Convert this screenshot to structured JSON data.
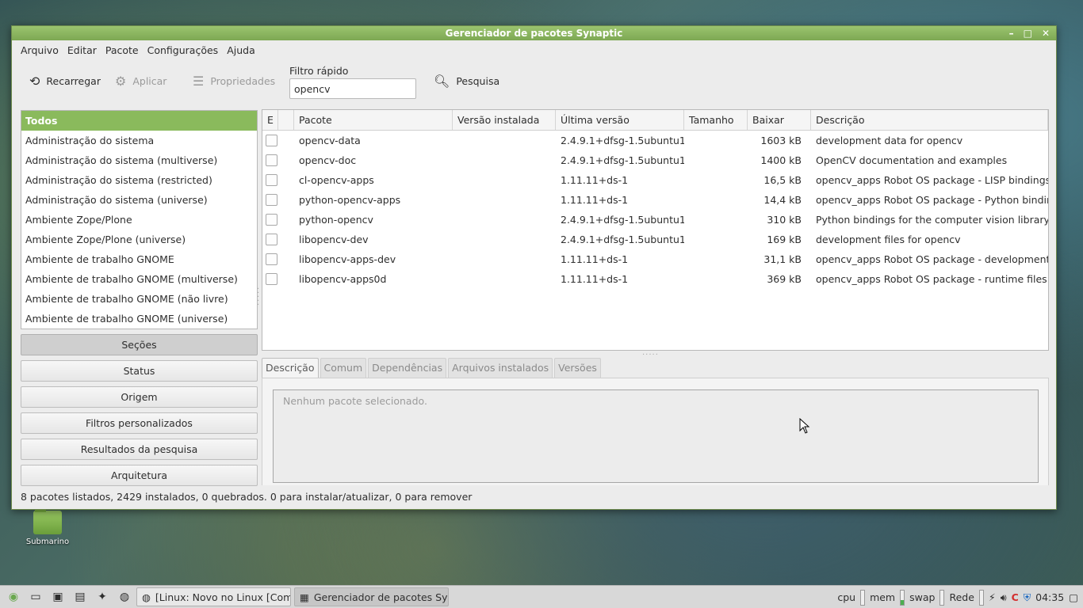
{
  "desktop": {
    "icon_label": "Submarino"
  },
  "window": {
    "title": "Gerenciador de pacotes Synaptic",
    "controls": [
      "–",
      "□",
      "✕"
    ]
  },
  "menu": [
    "Arquivo",
    "Editar",
    "Pacote",
    "Configurações",
    "Ajuda"
  ],
  "toolbar": {
    "reload": "Recarregar",
    "apply": "Aplicar",
    "properties": "Propriedades",
    "filter_label": "Filtro rápido",
    "filter_value": "opencv",
    "search": "Pesquisa"
  },
  "categories": [
    "Todos",
    "Administração do sistema",
    "Administração do sistema (multiverse)",
    "Administração do sistema (restricted)",
    "Administração do sistema (universe)",
    "Ambiente Zope/Plone",
    "Ambiente Zope/Plone (universe)",
    "Ambiente de trabalho GNOME",
    "Ambiente de trabalho GNOME (multiverse)",
    "Ambiente de trabalho GNOME (não livre)",
    "Ambiente de trabalho GNOME (universe)"
  ],
  "side_buttons": [
    "Seções",
    "Status",
    "Origem",
    "Filtros personalizados",
    "Resultados da pesquisa",
    "Arquitetura"
  ],
  "table": {
    "headers": [
      "E",
      "",
      "Pacote",
      "Versão instalada",
      "Última versão",
      "Tamanho",
      "Baixar",
      "Descrição"
    ],
    "rows": [
      {
        "pkg": "opencv-data",
        "installed": "",
        "latest": "2.4.9.1+dfsg-1.5ubuntu1.1",
        "size": "",
        "download": "1603 kB",
        "desc": "development data for opencv"
      },
      {
        "pkg": "opencv-doc",
        "installed": "",
        "latest": "2.4.9.1+dfsg-1.5ubuntu1.1",
        "size": "",
        "download": "1400 kB",
        "desc": "OpenCV documentation and examples"
      },
      {
        "pkg": "cl-opencv-apps",
        "installed": "",
        "latest": "1.11.11+ds-1",
        "size": "",
        "download": "16,5 kB",
        "desc": "opencv_apps Robot OS package - LISP bindings"
      },
      {
        "pkg": "python-opencv-apps",
        "installed": "",
        "latest": "1.11.11+ds-1",
        "size": "",
        "download": "14,4 kB",
        "desc": "opencv_apps Robot OS package - Python bindings"
      },
      {
        "pkg": "python-opencv",
        "installed": "",
        "latest": "2.4.9.1+dfsg-1.5ubuntu1.1",
        "size": "",
        "download": "310 kB",
        "desc": "Python bindings for the computer vision library"
      },
      {
        "pkg": "libopencv-dev",
        "installed": "",
        "latest": "2.4.9.1+dfsg-1.5ubuntu1.1",
        "size": "",
        "download": "169 kB",
        "desc": "development files for opencv"
      },
      {
        "pkg": "libopencv-apps-dev",
        "installed": "",
        "latest": "1.11.11+ds-1",
        "size": "",
        "download": "31,1 kB",
        "desc": "opencv_apps Robot OS package - development files"
      },
      {
        "pkg": "libopencv-apps0d",
        "installed": "",
        "latest": "1.11.11+ds-1",
        "size": "",
        "download": "369 kB",
        "desc": "opencv_apps Robot OS package - runtime files"
      }
    ]
  },
  "tabs": [
    "Descrição",
    "Comum",
    "Dependências",
    "Arquivos instalados",
    "Versões"
  ],
  "description_placeholder": "Nenhum pacote selecionado.",
  "status": "8 pacotes listados, 2429 instalados, 0 quebrados. 0 para instalar/atualizar, 0 para remover",
  "taskbar": {
    "tasks": [
      "[Linux: Novo no Linux [Comu...",
      "Gerenciador de pacotes Syn..."
    ],
    "tray": {
      "cpu": "cpu",
      "mem": "mem",
      "swap": "swap",
      "net": "Rede",
      "clock": "04:35"
    }
  }
}
